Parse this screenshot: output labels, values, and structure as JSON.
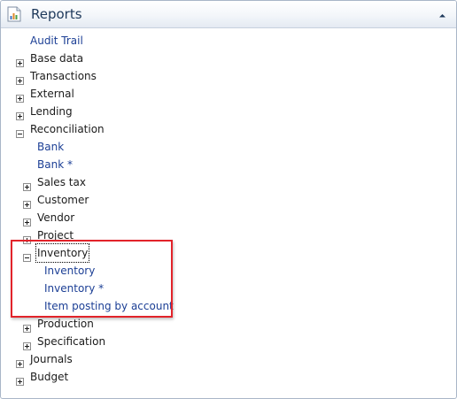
{
  "header": {
    "title": "Reports",
    "icon": "report-chart-icon",
    "collapse_icon": "chevron-up-icon"
  },
  "tree": {
    "audit_trail": "Audit Trail",
    "base_data": "Base data",
    "transactions": "Transactions",
    "external": "External",
    "lending": "Lending",
    "reconciliation": {
      "label": "Reconciliation",
      "bank": "Bank",
      "bank_star": "Bank *",
      "sales_tax": "Sales tax",
      "customer": "Customer",
      "vendor": "Vendor",
      "project": "Project",
      "inventory": {
        "label": "Inventory",
        "item_inventory": "Inventory",
        "item_inventory_star": "Inventory *",
        "item_posting": "Item posting by account"
      },
      "production": "Production",
      "specification": "Specification"
    },
    "journals": "Journals",
    "budget": "Budget"
  },
  "colors": {
    "link": "#1c3f95",
    "highlight_border": "#e2232a",
    "header_title": "#1e395b"
  }
}
